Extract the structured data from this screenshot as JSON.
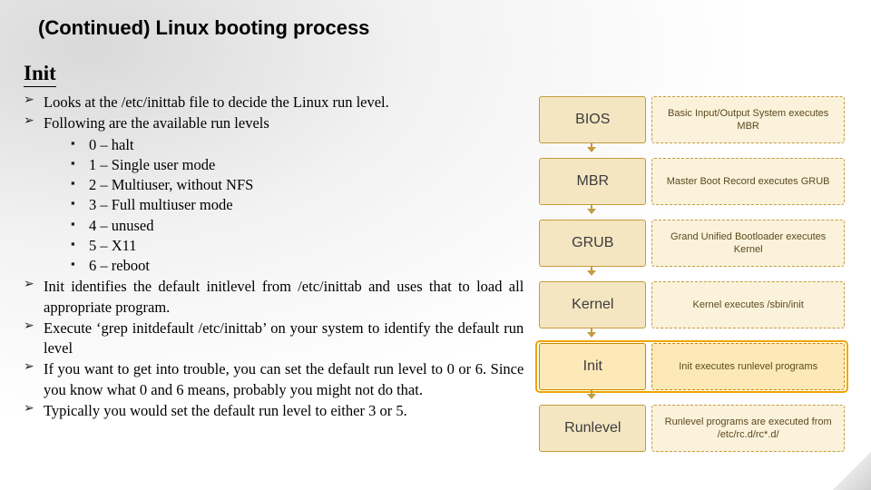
{
  "title": "(Continued) Linux booting process",
  "section": "Init",
  "bullets": {
    "b0": "Looks at the /etc/inittab file to decide the Linux run level.",
    "b1": "Following are the available run levels",
    "b2": "Init identifies the default initlevel from /etc/inittab and uses that to load all appropriate program.",
    "b3": "Execute ‘grep initdefault /etc/inittab’ on your system to identify the default run level",
    "b4": "If you want to get into trouble, you can set the default run level to 0 or 6. Since you know what 0 and 6 means, probably you might not do that.",
    "b5": "Typically you would set the default run level to either 3 or 5."
  },
  "runlevels": {
    "r0": "0 – halt",
    "r1": "1 – Single user mode",
    "r2": "2 – Multiuser, without NFS",
    "r3": "3 – Full multiuser mode",
    "r4": "4 – unused",
    "r5": "5 – X11",
    "r6": "6 – reboot"
  },
  "diagram": {
    "stages": {
      "s0": {
        "label": "BIOS",
        "desc": "Basic Input/Output System executes MBR"
      },
      "s1": {
        "label": "MBR",
        "desc": "Master Boot Record executes GRUB"
      },
      "s2": {
        "label": "GRUB",
        "desc": "Grand Unified Bootloader executes Kernel"
      },
      "s3": {
        "label": "Kernel",
        "desc": "Kernel executes /sbin/init"
      },
      "s4": {
        "label": "Init",
        "desc": "Init executes runlevel programs"
      },
      "s5": {
        "label": "Runlevel",
        "desc": "Runlevel programs are executed from /etc/rc.d/rc*.d/"
      }
    }
  }
}
